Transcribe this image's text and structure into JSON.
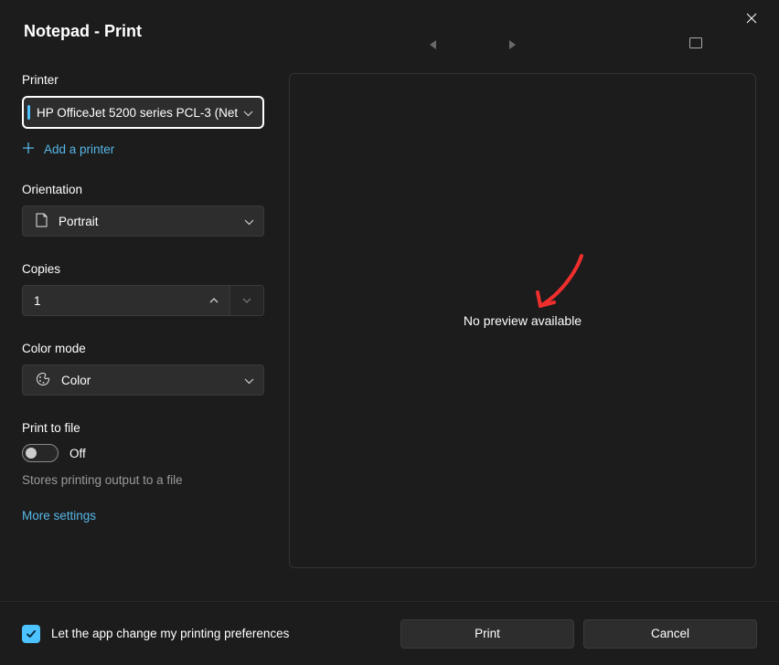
{
  "title": "Notepad - Print",
  "printer": {
    "label": "Printer",
    "selected": "HP OfficeJet 5200 series PCL-3 (Net",
    "add_label": "Add a printer"
  },
  "orientation": {
    "label": "Orientation",
    "selected": "Portrait"
  },
  "copies": {
    "label": "Copies",
    "value": "1"
  },
  "color_mode": {
    "label": "Color mode",
    "selected": "Color"
  },
  "print_to_file": {
    "label": "Print to file",
    "state": "Off",
    "help": "Stores printing output to a file"
  },
  "more_settings": "More settings",
  "preview": {
    "message": "No preview available"
  },
  "footer": {
    "checkbox_label": "Let the app change my printing preferences",
    "print": "Print",
    "cancel": "Cancel"
  }
}
